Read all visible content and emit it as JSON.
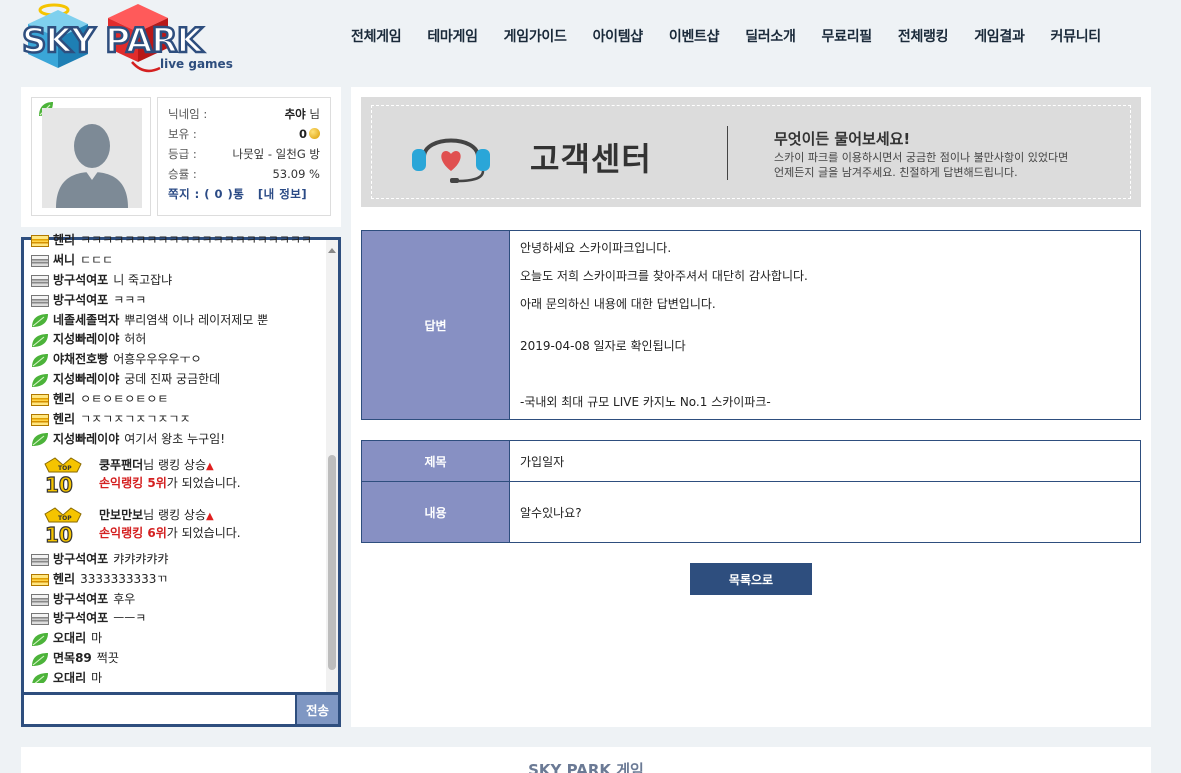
{
  "header": {
    "logo_text": "SKY PARK",
    "logo_sub": "live games",
    "nav": [
      "전체게임",
      "테마게임",
      "게임가이드",
      "아이템샵",
      "이벤트샵",
      "딜러소개",
      "무료리필",
      "전체랭킹",
      "게임결과",
      "커뮤니티"
    ]
  },
  "profile": {
    "nick_label": "닉네임 :",
    "nick_value": "추야",
    "nick_suffix": "님",
    "hold_label": "보유 :",
    "hold_value": "0",
    "grade_label": "등급 :",
    "grade_value": "나뭇잎 - 일천G 방",
    "winrate_label": "승률 :",
    "winrate_value": "53.09 %",
    "message_label": "쪽지 : ( 0 )통",
    "myinfo_label": "[내 정보]"
  },
  "chat": {
    "lines": [
      {
        "lv": "gold",
        "nick": "헨리",
        "msg": "ㅋㅋㅋㅋㅋㅋㅋㅋㅋㅋㅋㅋㅋㅋㅋㅋㅋㅋㅋㅋㅋ"
      },
      {
        "lv": "gray",
        "nick": "써니",
        "msg": "ㄷㄷㄷ"
      },
      {
        "lv": "gray",
        "nick": "방구석여포",
        "msg": "니 죽고잡냐"
      },
      {
        "lv": "gray",
        "nick": "방구석여포",
        "msg": "ㅋㅋㅋ"
      },
      {
        "lv": "leaf",
        "nick": "네졸세졸먹자",
        "msg": "뿌리염색 이나 레이저제모 뿐"
      },
      {
        "lv": "leaf",
        "nick": "지성빠레이야",
        "msg": "허허"
      },
      {
        "lv": "leaf",
        "nick": "야채전호빵",
        "msg": "어흥우우우우ㅜㅇ"
      },
      {
        "lv": "leaf",
        "nick": "지성빠레이야",
        "msg": "궁데 진짜 궁금한데"
      },
      {
        "lv": "gold",
        "nick": "헨리",
        "msg": "ㅇㅌㅇㅌㅇㅌㅇㅌ"
      },
      {
        "lv": "gold",
        "nick": "헨리",
        "msg": "ㄱㅈㄱㅈㄱㅈㄱㅈㄱㅈ"
      },
      {
        "lv": "leaf",
        "nick": "지성빠레이야",
        "msg": "여기서 왕초 누구임!"
      }
    ],
    "rank_events": [
      {
        "nick": "쿵푸팬더",
        "suffix": "님 랭킹 상승",
        "rank_text": "손익랭킹 5위",
        "tail": "가 되었습니다."
      },
      {
        "nick": "만보만보",
        "suffix": "님 랭킹 상승",
        "rank_text": "손익랭킹 6위",
        "tail": "가 되었습니다."
      }
    ],
    "lines_after": [
      {
        "lv": "gray",
        "nick": "방구석여포",
        "msg": "캬캬캬캬캬"
      },
      {
        "lv": "gold",
        "nick": "헨리",
        "msg": "3333333333ㄲ"
      },
      {
        "lv": "gray",
        "nick": "방구석여포",
        "msg": "후우"
      },
      {
        "lv": "gray",
        "nick": "방구석여포",
        "msg": "ㅡㅡㅋ"
      },
      {
        "lv": "leaf",
        "nick": "오대리",
        "msg": "마"
      },
      {
        "lv": "leaf",
        "nick": "면목89",
        "msg": "쩍끗"
      },
      {
        "lv": "leaf",
        "nick": "오대리",
        "msg": "마"
      }
    ],
    "input_placeholder": "",
    "send_label": "전송"
  },
  "cs": {
    "title": "고객센터",
    "subtitle": "무엇이든 물어보세요!",
    "desc1": "스카이 파크를 이용하시면서 궁금한 점이나 불만사항이 있었다면",
    "desc2": "언제든지 글을 남겨주세요. 친절하게 답변해드립니다."
  },
  "answer": {
    "label": "답변",
    "line1": "안녕하세요 스카이파크입니다.",
    "line2": "오늘도 저희 스카이파크를 찾아주셔서 대단히 감사합니다.",
    "line3": "아래 문의하신 내용에 대한 답변입니다.",
    "line4": "2019-04-08 일자로 확인됩니다",
    "line5": "-국내외 최대 규모 LIVE 카지노 No.1 스카이파크-"
  },
  "question": {
    "title_label": "제목",
    "title_value": "가입일자",
    "content_label": "내용",
    "content_value": "알수있나요?"
  },
  "list_button": "목록으로",
  "footer_title": "SKY PARK 게임",
  "colors": {
    "navy": "#2e4e7e",
    "label_purple": "#8790c3",
    "background": "#eef2f5"
  }
}
